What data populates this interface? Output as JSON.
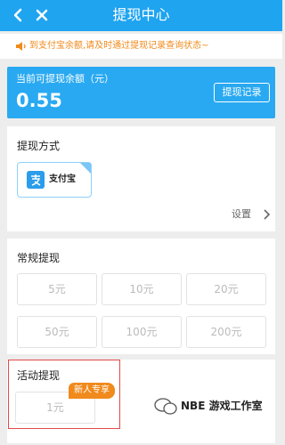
{
  "header": {
    "title": "提现中心"
  },
  "notice": {
    "text": "到支付宝余额,请及时通过提现记录查询状态~"
  },
  "balance": {
    "label": "当前可提现余额（元）",
    "amount": "0.55",
    "record_button": "提现记录"
  },
  "method": {
    "title": "提现方式",
    "option": "支付宝",
    "settings": "设置"
  },
  "regular": {
    "title": "常规提现",
    "amounts": [
      "5元",
      "10元",
      "20元",
      "50元",
      "100元",
      "200元"
    ]
  },
  "activity": {
    "title": "活动提现",
    "tag": "新人专享",
    "amount": "1元"
  },
  "watermark": {
    "text": "NBE 游戏工作室"
  },
  "colors": {
    "header": "#1fa4f0",
    "accent": "#f08a1c",
    "alert": "#e74747"
  }
}
